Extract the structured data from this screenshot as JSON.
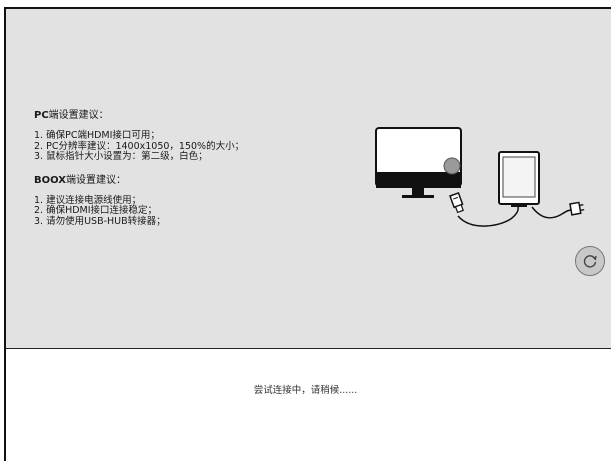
{
  "pc_section": {
    "title_bold": "PC",
    "title_rest": "端设置建议：",
    "items": [
      "1. 确保PC端HDMI接口可用；",
      "2. PC分辨率建议：1400x1050，150%的大小；",
      "3. 鼠标指针大小设置为：第二级，白色；"
    ]
  },
  "boox_section": {
    "title_bold": "BOOX",
    "title_rest": "端设置建议：",
    "items": [
      "1. 建议连接电源线使用；",
      "2. 确保HDMI接口连接稳定；",
      "3. 请勿使用USB-HUB转接器；"
    ]
  },
  "status_text": "尝试连接中，请稍候......",
  "icons": {
    "illustration": "monitor-to-ereader-hdmi-illustration",
    "refresh": "refresh-icon"
  }
}
